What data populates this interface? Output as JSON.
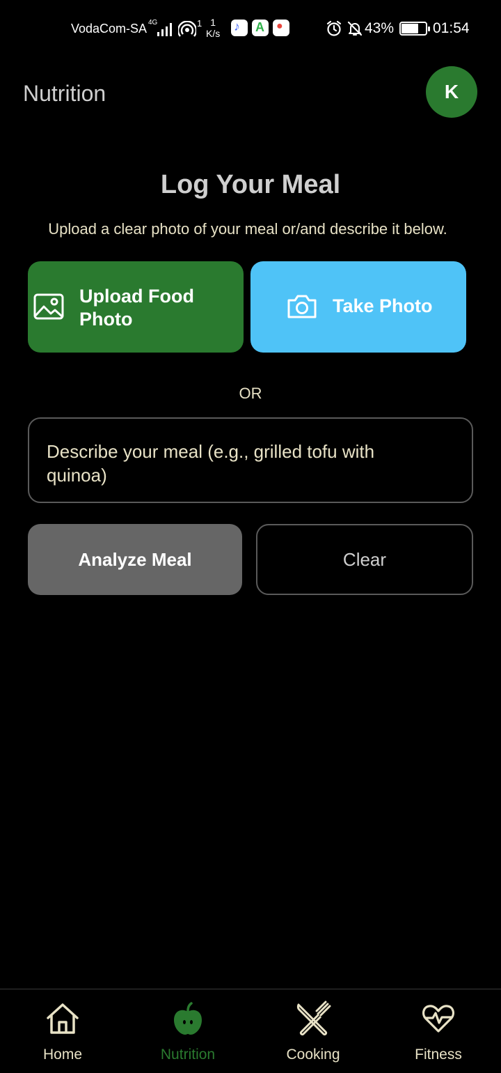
{
  "status_bar": {
    "carrier": "VodaCom-SA",
    "network_type": "4G",
    "hotspot_count": "1",
    "speed_value": "1",
    "speed_unit": "K/s",
    "battery": "43%",
    "time": "01:54",
    "icons": [
      "signal-icon",
      "hotspot-icon",
      "music-app-icon",
      "apk-app-icon",
      "maps-app-icon",
      "alarm-icon",
      "mute-icon",
      "battery-icon"
    ]
  },
  "header": {
    "title": "Nutrition",
    "avatar_initial": "K"
  },
  "main": {
    "heading": "Log Your Meal",
    "instructions": "Upload a clear photo of your meal or/and describe it below.",
    "upload_label": "Upload Food Photo",
    "camera_label": "Take Photo",
    "or_text": "OR",
    "meal_placeholder": "Describe your meal (e.g., grilled tofu with quinoa)",
    "analyze_label": "Analyze Meal",
    "clear_label": "Clear"
  },
  "nav": {
    "items": [
      {
        "label": "Home",
        "icon": "home-icon",
        "active": false
      },
      {
        "label": "Nutrition",
        "icon": "apple-icon",
        "active": true
      },
      {
        "label": "Cooking",
        "icon": "utensils-icon",
        "active": false
      },
      {
        "label": "Fitness",
        "icon": "heart-pulse-icon",
        "active": false
      }
    ]
  },
  "colors": {
    "background": "#000000",
    "primary_green": "#2a7a2f",
    "camera_blue": "#4fc3f7",
    "analyze_gray": "#666666",
    "text_cream": "#e8e2c6",
    "text_light_gray": "#cfcfcf"
  }
}
